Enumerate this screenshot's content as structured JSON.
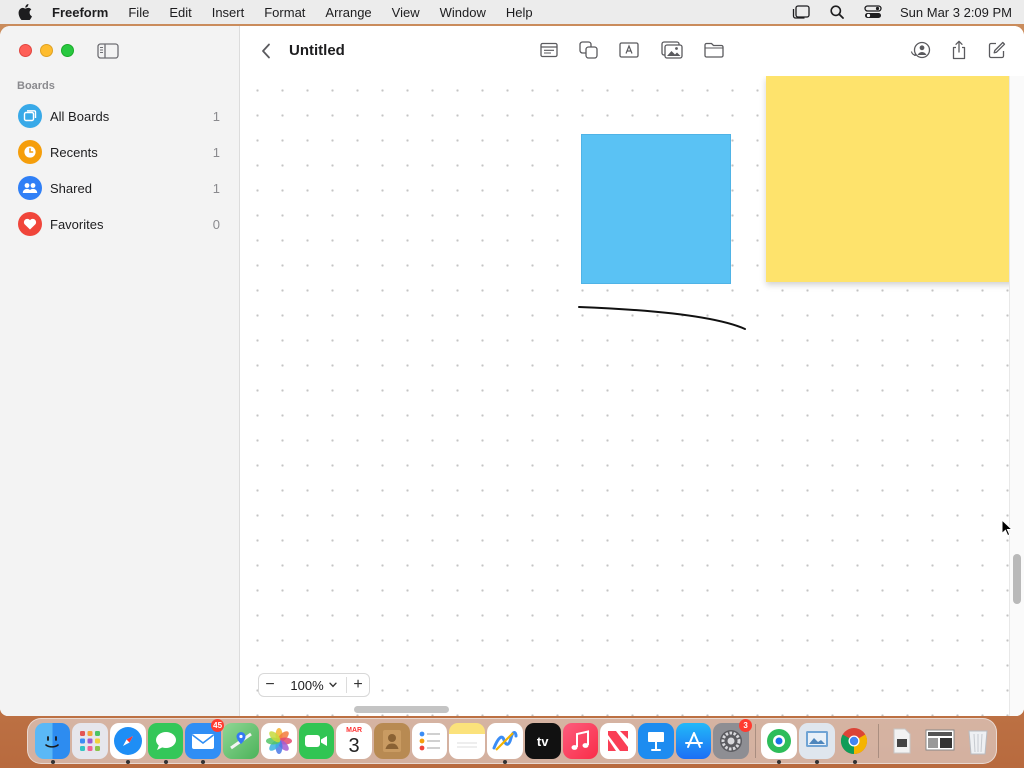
{
  "menubar": {
    "app_name": "Freeform",
    "items": [
      "File",
      "Edit",
      "Insert",
      "Format",
      "Arrange",
      "View",
      "Window",
      "Help"
    ],
    "datetime": "Sun Mar 3  2:09 PM"
  },
  "sidebar": {
    "section_title": "Boards",
    "items": [
      {
        "label": "All Boards",
        "count": "1",
        "icon": "boards-icon",
        "color": "#38a9e8"
      },
      {
        "label": "Recents",
        "count": "1",
        "icon": "clock-icon",
        "color": "#f59e0b"
      },
      {
        "label": "Shared",
        "count": "1",
        "icon": "people-icon",
        "color": "#2f7ff6"
      },
      {
        "label": "Favorites",
        "count": "0",
        "icon": "heart-icon",
        "color": "#f0453a"
      }
    ]
  },
  "toolbar": {
    "title": "Untitled",
    "tools": [
      "note-icon",
      "shapes-icon",
      "text-box-icon",
      "media-icon",
      "files-icon"
    ],
    "right_tools": [
      "collaborate-icon",
      "share-icon",
      "compose-icon"
    ]
  },
  "canvas": {
    "shapes": [
      {
        "type": "square",
        "color": "#5ac2f4"
      },
      {
        "type": "sticky-note",
        "color": "#fee36c"
      },
      {
        "type": "pen-stroke",
        "color": "#000000"
      }
    ]
  },
  "zoom": {
    "value": "100%",
    "minus": "−",
    "plus": "+"
  },
  "dock": {
    "apps": [
      {
        "name": "Finder",
        "color": "#2d8cf0",
        "running": true
      },
      {
        "name": "Launchpad",
        "color": "#e8e8ee",
        "running": false
      },
      {
        "name": "Safari",
        "color": "#1e8ef5",
        "running": true
      },
      {
        "name": "Messages",
        "color": "#34c759",
        "running": true
      },
      {
        "name": "Mail",
        "color": "#2f8ef5",
        "running": true,
        "badge": "45"
      },
      {
        "name": "Maps",
        "color": "#4cb35a",
        "running": false
      },
      {
        "name": "Photos",
        "color": "#ffffff",
        "running": false
      },
      {
        "name": "FaceTime",
        "color": "#31c553",
        "running": false
      },
      {
        "name": "Calendar",
        "color": "#ffffff",
        "running": false,
        "month": "MAR",
        "day": "3"
      },
      {
        "name": "Contacts",
        "color": "#b88a52",
        "running": false
      },
      {
        "name": "Reminders",
        "color": "#ffffff",
        "running": false
      },
      {
        "name": "Notes",
        "color": "#fbe27b",
        "running": false
      },
      {
        "name": "Freeform",
        "color": "#ffffff",
        "running": true
      },
      {
        "name": "TV",
        "color": "#111111",
        "running": false,
        "label": "tv"
      },
      {
        "name": "Music",
        "color": "#fa3e55",
        "running": false
      },
      {
        "name": "News",
        "color": "#ffffff",
        "running": false
      },
      {
        "name": "Keynote",
        "color": "#1d8cf0",
        "running": false
      },
      {
        "name": "App Store",
        "color": "#1c8af5",
        "running": false
      },
      {
        "name": "System Settings",
        "color": "#8e8e93",
        "running": false,
        "badge": "3"
      },
      {
        "name": "Chrome Remote",
        "color": "#2dbd5a",
        "running": true
      },
      {
        "name": "Preview",
        "color": "#6fa3d4",
        "running": true
      },
      {
        "name": "Chrome",
        "color": "#ffffff",
        "running": true
      },
      {
        "name": "Document",
        "color": "#f0f0f0",
        "running": false
      },
      {
        "name": "Screenshot",
        "color": "#dcdcdc",
        "running": false
      },
      {
        "name": "Trash",
        "color": "#e5e7ea",
        "running": false
      }
    ]
  }
}
